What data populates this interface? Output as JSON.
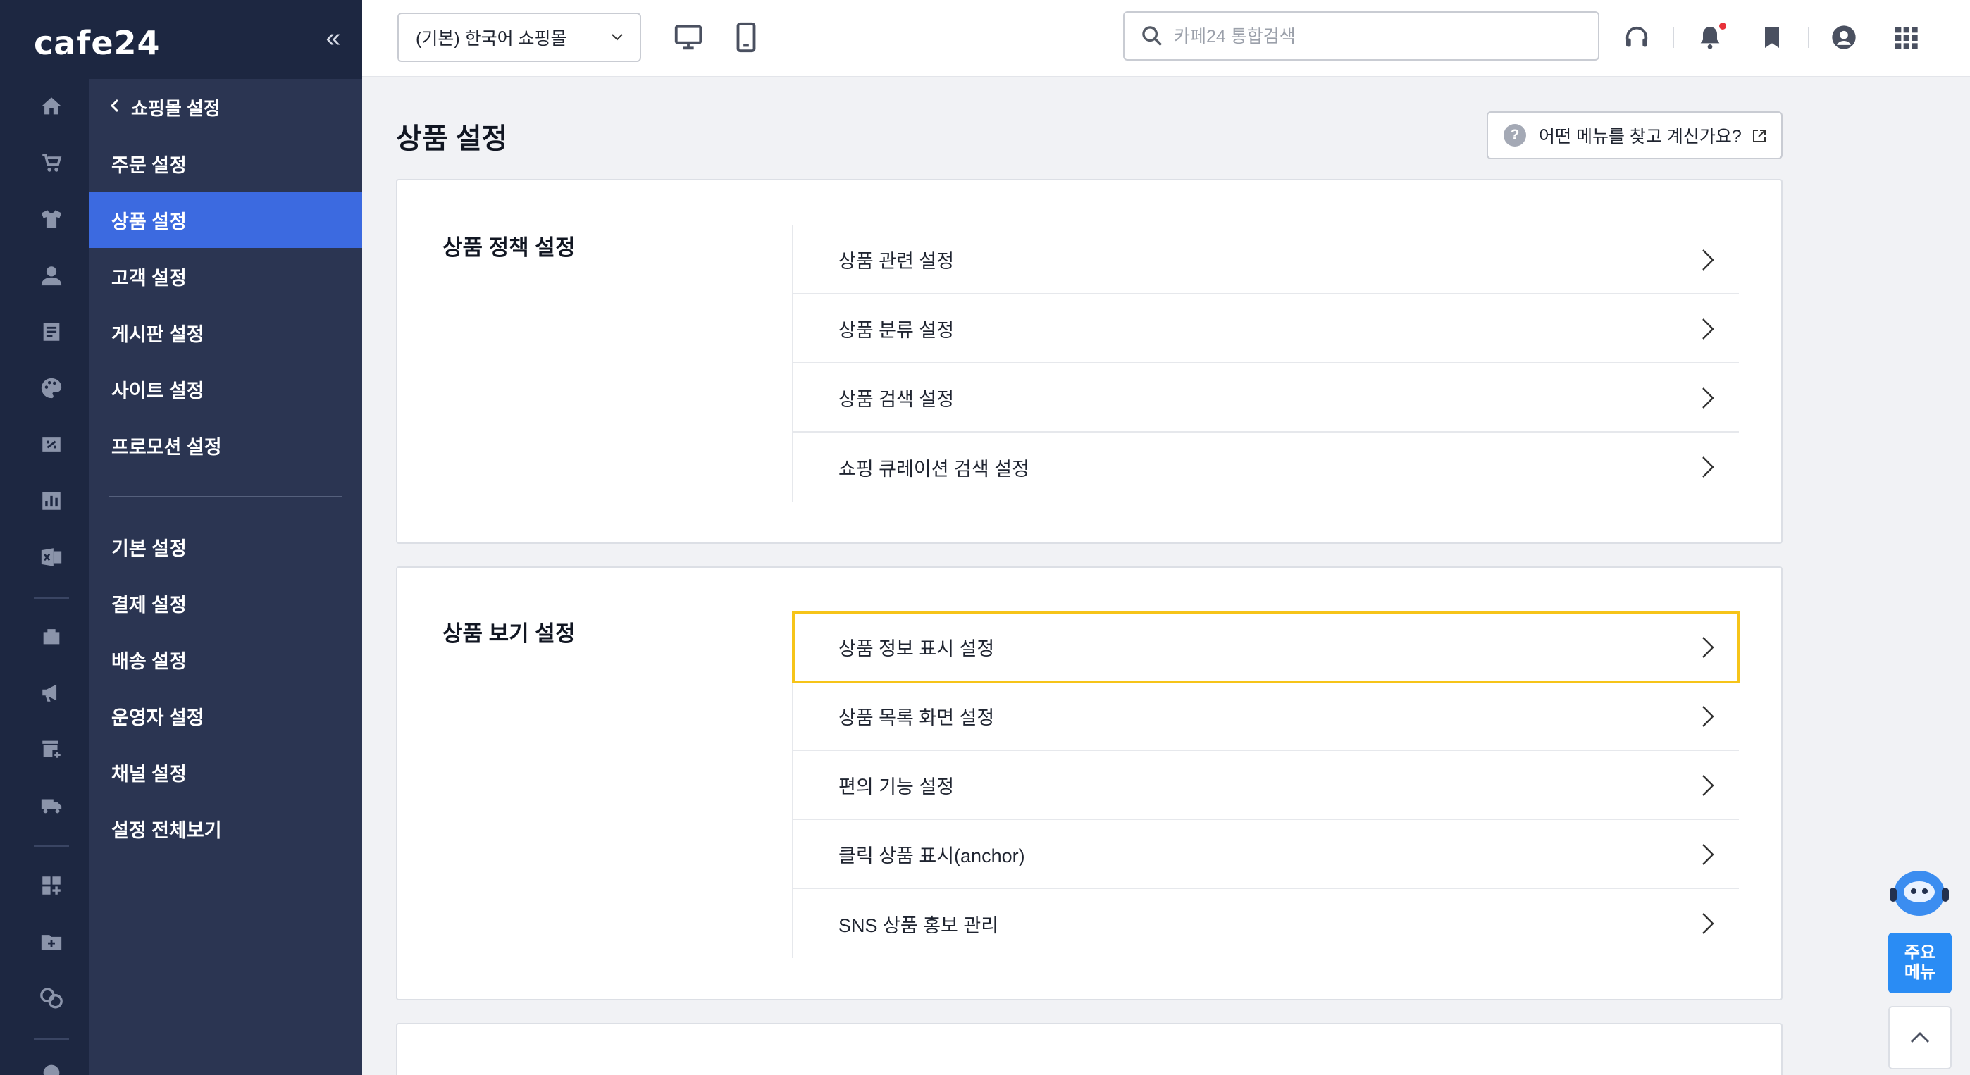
{
  "brand": {
    "logo": "cafe24"
  },
  "rail_icons": [
    "home-icon",
    "cart-icon",
    "shirt-icon",
    "user-icon",
    "board-icon",
    "palette-icon",
    "promotion-icon",
    "chart-icon",
    "excel-icon",
    "store-icon",
    "megaphone-icon",
    "shop-add-icon",
    "truck-icon",
    "apps-add-icon",
    "folder-add-icon",
    "copy-icon",
    "gear-icon"
  ],
  "subnav": {
    "back_label": "쇼핑몰 설정",
    "items": [
      {
        "label": "주문 설정"
      },
      {
        "label": "상품 설정",
        "active": true
      },
      {
        "label": "고객 설정"
      },
      {
        "label": "게시판 설정"
      },
      {
        "label": "사이트 설정"
      },
      {
        "label": "프로모션 설정"
      }
    ],
    "items2": [
      {
        "label": "기본 설정"
      },
      {
        "label": "결제 설정"
      },
      {
        "label": "배송 설정"
      },
      {
        "label": "운영자 설정"
      },
      {
        "label": "채널 설정"
      },
      {
        "label": "설정 전체보기"
      }
    ]
  },
  "topbar": {
    "mall_select": "(기본) 한국어 쇼핑몰",
    "search_placeholder": "카페24 통합검색"
  },
  "main": {
    "page_title": "상품 설정",
    "help_label": "어떤 메뉴를 찾고 계신가요?",
    "sections": [
      {
        "title": "상품 정책 설정",
        "items": [
          "상품 관련 설정",
          "상품 분류 설정",
          "상품 검색 설정",
          "쇼핑 큐레이션 검색 설정"
        ]
      },
      {
        "title": "상품 보기 설정",
        "items": [
          "상품 정보 표시 설정",
          "상품 목록 화면 설정",
          "편의 기능 설정",
          "클릭 상품 표시(anchor)",
          "SNS 상품 홍보 관리"
        ]
      }
    ]
  },
  "floating": {
    "quick_menu_line1": "주요",
    "quick_menu_line2": "메뉴"
  },
  "colors": {
    "rail": "#1d2741",
    "subnav": "#2b3552",
    "active": "#3c6ae0",
    "highlight": "#f6c419",
    "quick_menu": "#2a8cf4"
  }
}
